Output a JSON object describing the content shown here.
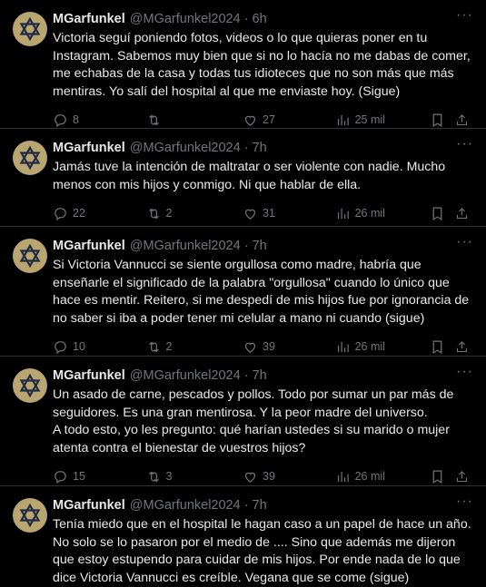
{
  "tweets": [
    {
      "name": "MGarfunkel",
      "handle": "@MGarfunkel2024",
      "sep": "·",
      "time": "6h",
      "text": "Victoria seguí poniendo fotos, videos o lo que quieras poner en tu Instagram. Sabemos muy bien que si no lo hacía no me dabas de comer, me echabas de la casa y todas tus idioteces que no son más que más mentiras. Yo salí del hospital al que me enviaste hoy. (Sigue)",
      "replies": "8",
      "retweets": "",
      "likes": "27",
      "views": "25 mil"
    },
    {
      "name": "MGarfunkel",
      "handle": "@MGarfunkel2024",
      "sep": "·",
      "time": "7h",
      "text": "Jamás tuve la intención de maltratar o ser violente con nadie. Mucho menos con mis hijos y conmigo. Ni que hablar de ella.",
      "replies": "22",
      "retweets": "2",
      "likes": "31",
      "views": "26 mil"
    },
    {
      "name": "MGarfunkel",
      "handle": "@MGarfunkel2024",
      "sep": "·",
      "time": "7h",
      "text": "Si Victoria Vannucci se siente orgullosa como madre, habría que enseñarle el significado de la palabra \"orgullosa\" cuando lo único que hace es mentir. Reitero, si me despedí de mis hijos fue por ignorancia de no saber si iba a poder tener mi celular a mano ni cuando (sigue)",
      "replies": "10",
      "retweets": "2",
      "likes": "39",
      "views": "26 mil"
    },
    {
      "name": "MGarfunkel",
      "handle": "@MGarfunkel2024",
      "sep": "·",
      "time": "7h",
      "text": "Un asado de carne, pescados y pollos. Todo por sumar un par más de seguidores. Es una gran mentirosa. Y la peor madre del universo.\nA todo esto, yo les pregunto: qué harían ustedes si su marido o mujer atenta contra el bienestar de vuestros hijos?",
      "replies": "15",
      "retweets": "3",
      "likes": "39",
      "views": "26 mil"
    },
    {
      "name": "MGarfunkel",
      "handle": "@MGarfunkel2024",
      "sep": "·",
      "time": "7h",
      "text": "Tenía miedo que en el hospital le hagan caso a un papel de hace un año. No solo se lo pasaron por el medio de .... Sino que además me dijeron que estoy estupendo para cuidar de mis hijos. Por ende nada de lo que dice Victoria Vannucci es creíble. Vegana que se come (sigue)",
      "replies": "",
      "retweets": "",
      "likes": "",
      "views": ""
    }
  ],
  "icons": {
    "avatar": "star-of-david-icon",
    "more": "more-horizontal-icon",
    "reply": "reply-icon",
    "retweet": "retweet-icon",
    "like": "heart-icon",
    "views": "views-icon",
    "bookmark": "bookmark-icon",
    "share": "share-icon"
  },
  "colors": {
    "background": "#000000",
    "text": "#e7e9ea",
    "muted": "#71767b",
    "border": "#2f3336",
    "avatar_bg": "#b8a56f"
  }
}
